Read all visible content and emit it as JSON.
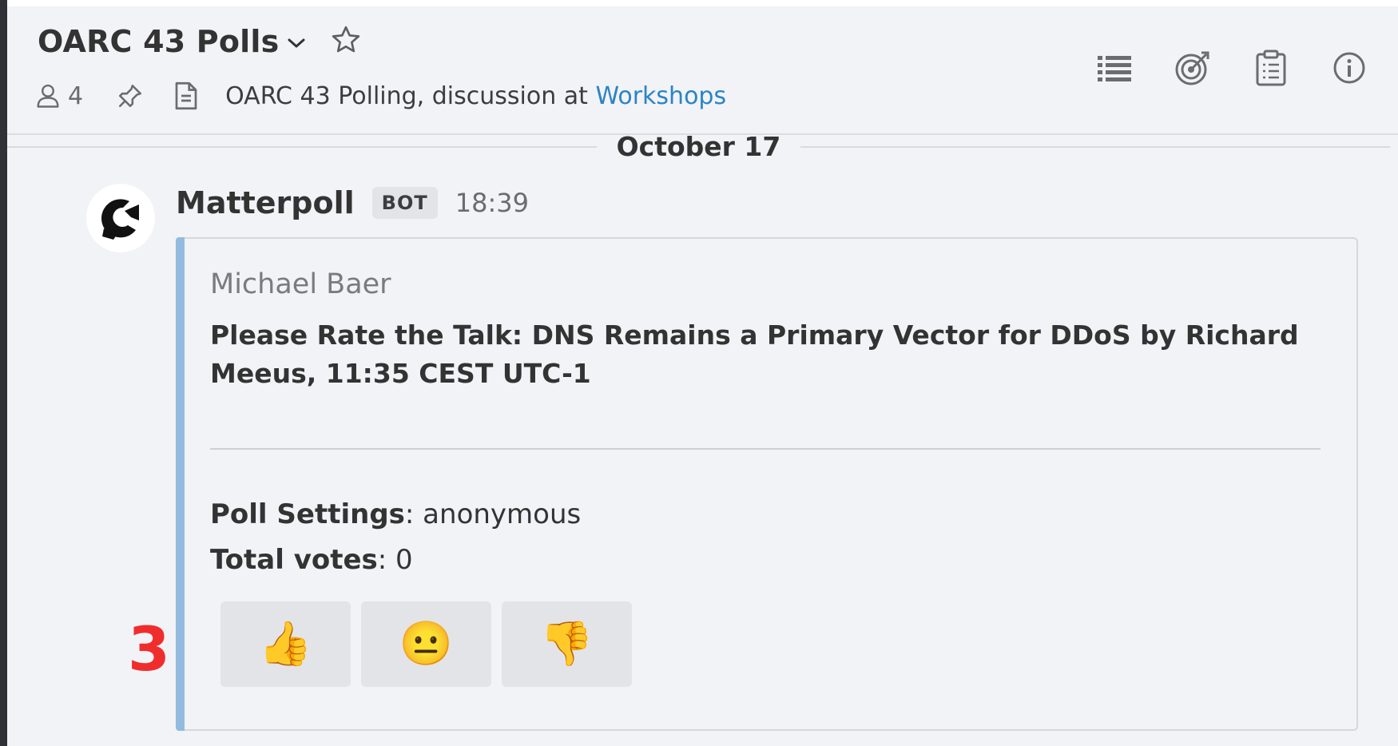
{
  "channel": {
    "name": "OARC 43 Polls",
    "member_count": "4",
    "purpose_text": "OARC 43 Polling, discussion at ",
    "purpose_link": "Workshops"
  },
  "header_icons": [
    "list-icon",
    "target-icon",
    "clipboard-icon",
    "info-icon"
  ],
  "date_separator": "October 17",
  "message": {
    "username": "Matterpoll",
    "badge": "BOT",
    "time": "18:39",
    "attachment": {
      "author": "Michael Baer",
      "title": "Please Rate the Talk: DNS Remains a Primary Vector for DDoS by Richard Meeus, 11:35 CEST UTC-1",
      "settings_label": "Poll Settings",
      "settings_value": ": anonymous",
      "votes_label": "Total votes",
      "votes_value": ": 0",
      "accent_color": "#93bbdf"
    },
    "vote_buttons": [
      {
        "emoji": "👍",
        "name": "thumbs-up"
      },
      {
        "emoji": "😐",
        "name": "neutral-face"
      },
      {
        "emoji": "👎",
        "name": "thumbs-down"
      }
    ]
  },
  "annotation_number": "3",
  "colors": {
    "link": "#2b84c6",
    "annotation": "#f02d2d",
    "background": "#f2f3f6"
  }
}
